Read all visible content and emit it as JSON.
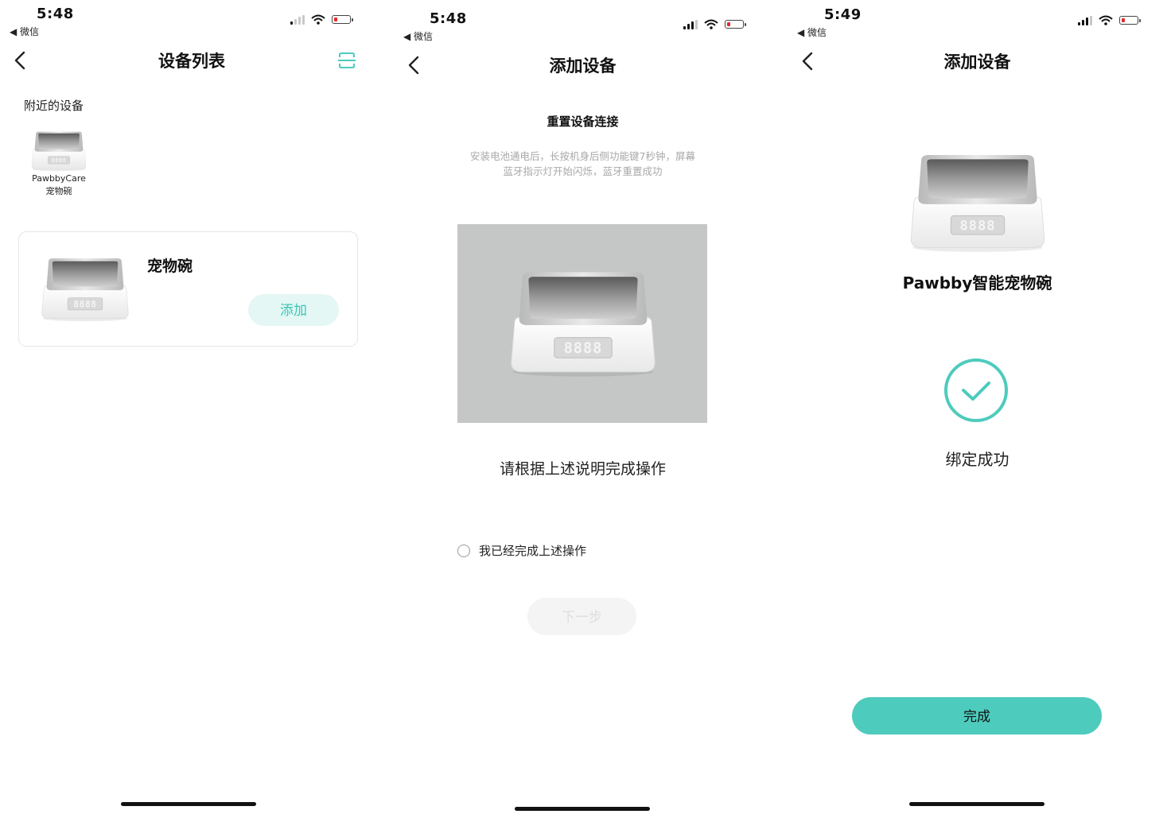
{
  "colors": {
    "accent": "#4dcbbd",
    "accent_light": "#e4f7f4",
    "accent_text": "#3cc6b4",
    "battery_low": "#e32b2b",
    "disabled_bg": "#f4f4f4",
    "disabled_text": "#dedede",
    "hint_text": "#a8a8a8"
  },
  "screen1": {
    "status": {
      "time": "5:48",
      "back_app": "◀ 微信"
    },
    "nav": {
      "back_icon": "chevron-left-icon",
      "title": "设备列表",
      "scan_icon": "scan-icon"
    },
    "section_label": "附近的设备",
    "nearby_device": {
      "name_line1": "PawbbyCare",
      "name_line2": "宠物碗"
    },
    "device_card": {
      "title": "宠物碗",
      "add_label": "添加"
    }
  },
  "screen2": {
    "status": {
      "time": "5:48",
      "back_app": "◀ 微信"
    },
    "nav": {
      "back_icon": "chevron-left-icon",
      "title": "添加设备"
    },
    "step_title": "重置设备连接",
    "step_desc_line1": "安装电池通电后，长按机身后侧功能键7秒钟，屏幕",
    "step_desc_line2": "蓝牙指示灯开始闪烁，蓝牙重置成功",
    "instruction": "请根据上述说明完成操作",
    "confirm_label": "我已经完成上述操作",
    "confirm_checked": false,
    "next_label": "下一步",
    "next_enabled": false
  },
  "screen3": {
    "status": {
      "time": "5:49",
      "back_app": "◀ 微信"
    },
    "nav": {
      "back_icon": "chevron-left-icon",
      "title": "添加设备"
    },
    "product_name": "Pawbby智能宠物碗",
    "success_icon": "check-circle-icon",
    "success_text": "绑定成功",
    "done_label": "完成"
  },
  "display_digits": "8888"
}
